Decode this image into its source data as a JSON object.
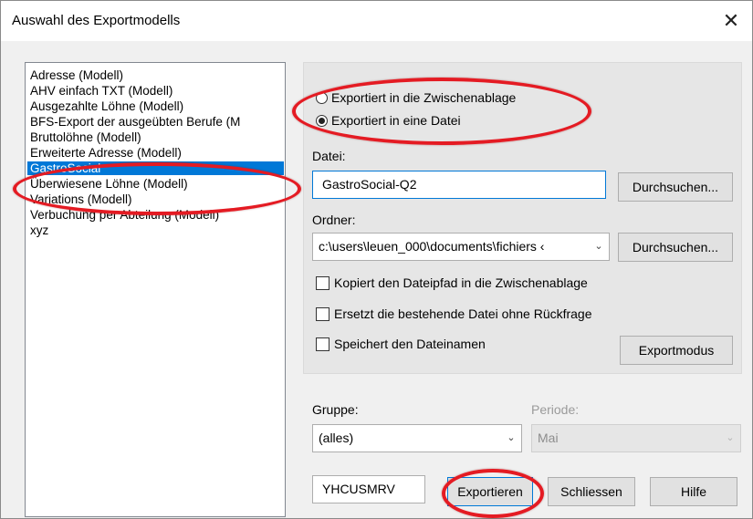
{
  "window": {
    "title": "Auswahl des Exportmodells",
    "close_glyph": "✕"
  },
  "models": {
    "items": [
      "Adresse (Modell)",
      "AHV einfach TXT (Modell)",
      "Ausgezahlte Löhne (Modell)",
      "BFS-Export der ausgeübten Berufe (M",
      "Bruttolöhne (Modell)",
      "Erweiterte Adresse (Modell)",
      "GastroSocial",
      "Überwiesene Löhne (Modell)",
      "Variations (Modell)",
      "Verbuchung per Abteilung (Modell)",
      "xyz"
    ],
    "selected": "GastroSocial"
  },
  "export_target": {
    "clipboard_label": "Exportiert in die Zwischenablage",
    "file_label": "Exportiert in eine Datei",
    "selected": "file"
  },
  "file": {
    "label": "Datei:",
    "value": "GastroSocial-Q2",
    "browse_label": "Durchsuchen..."
  },
  "folder": {
    "label": "Ordner:",
    "value": "c:\\users\\leuen_000\\documents\\fichiers ‹",
    "browse_label": "Durchsuchen..."
  },
  "options": {
    "copy_path_label": "Kopiert den Dateipfad in die Zwischenablage",
    "replace_label": "Ersetzt die bestehende Datei ohne Rückfrage",
    "save_name_label": "Speichert den Dateinamen",
    "copy_path_checked": false,
    "replace_checked": false,
    "save_name_checked": false
  },
  "export_mode_label": "Exportmodus",
  "group": {
    "label": "Gruppe:",
    "value": "(alles)"
  },
  "period": {
    "label": "Periode:",
    "value": "Mai"
  },
  "code": "YHCUSMRV",
  "buttons": {
    "export": "Exportieren",
    "close": "Schliessen",
    "help": "Hilfe"
  },
  "icons": {
    "dropdown": "chevron-down-icon",
    "close": "close-icon"
  },
  "colors": {
    "selection": "#0078d7",
    "annotation": "#e41b23",
    "focus_border": "#0078d7"
  }
}
